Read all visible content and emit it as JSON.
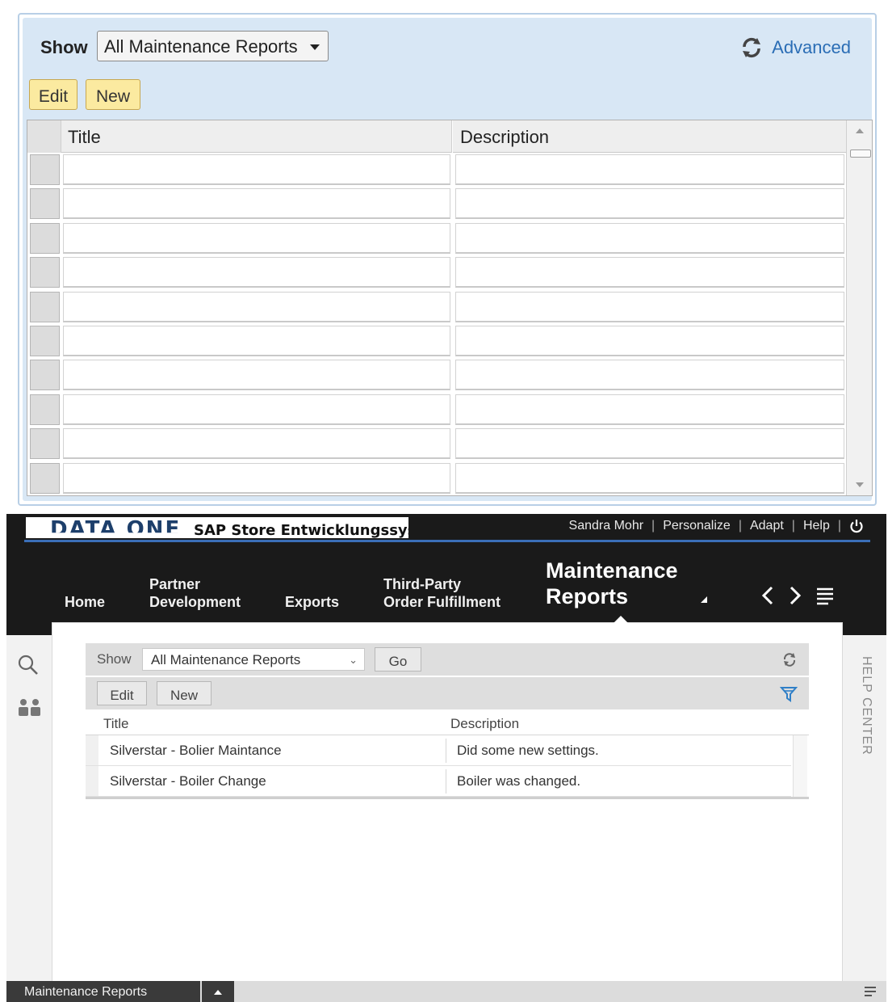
{
  "top_panel": {
    "show_label": "Show",
    "show_selected": "All Maintenance Reports",
    "advanced_link": "Advanced",
    "toolbar": {
      "edit": "Edit",
      "new": "New"
    },
    "columns": [
      "Title",
      "Description"
    ],
    "empty_rows": 10
  },
  "shell": {
    "brand_logo": "DATA ONE",
    "system_name": "SAP Store Entwicklungssystem",
    "user_links": [
      "Sandra Mohr",
      "Personalize",
      "Adapt",
      "Help"
    ],
    "nav": {
      "home": "Home",
      "partner_1": "Partner",
      "partner_2": "Development",
      "exports": "Exports",
      "third_1": "Third-Party",
      "third_2": "Order Fulfillment",
      "active_1": "Maintenance",
      "active_2": "Reports"
    },
    "side_help": "HELP CENTER",
    "report": {
      "show_label": "Show",
      "show_selected": "All Maintenance Reports",
      "go_button": "Go",
      "edit_button": "Edit",
      "new_button": "New",
      "columns": [
        "Title",
        "Description"
      ],
      "rows": [
        {
          "title": "Silverstar - Bolier Maintance",
          "description": "Did some new settings."
        },
        {
          "title": "Silverstar - Boiler Change",
          "description": "Boiler was changed."
        }
      ]
    },
    "status_tab": "Maintenance Reports"
  },
  "colors": {
    "accent_blue": "#3b6fb8",
    "panel_bg": "#d8e7f5",
    "button_yellow": "#fbeaa0",
    "shell_dark": "#1a1a1a"
  },
  "icons": [
    "refresh-icon",
    "dropdown-caret-icon",
    "power-icon",
    "chevron-left-icon",
    "chevron-right-icon",
    "menu-icon",
    "search-icon",
    "users-icon",
    "filter-icon"
  ]
}
